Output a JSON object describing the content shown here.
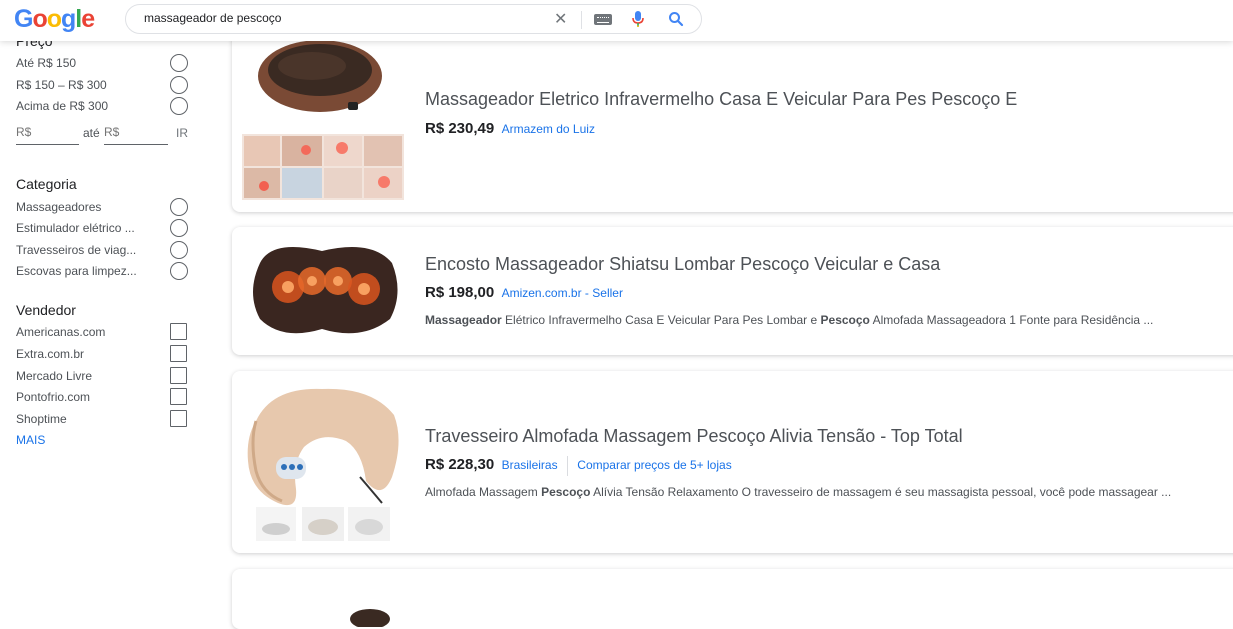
{
  "search": {
    "query": "massageador de pescoço"
  },
  "logo_text": "Google",
  "sidebar": {
    "price": {
      "heading": "Preço",
      "options": [
        "Até R$ 150",
        "R$ 150 – R$ 300",
        "Acima de R$ 300"
      ],
      "min_placeholder": "R$",
      "between": "até",
      "max_placeholder": "R$",
      "go": "IR"
    },
    "category": {
      "heading": "Categoria",
      "options": [
        "Massageadores",
        "Estimulador elétrico ...",
        "Travesseiros de viag...",
        "Escovas para limpez..."
      ]
    },
    "seller": {
      "heading": "Vendedor",
      "options": [
        "Americanas.com",
        "Extra.com.br",
        "Mercado Livre",
        "Pontofrio.com",
        "Shoptime"
      ],
      "more": "MAIS"
    }
  },
  "results": [
    {
      "title": "Massageador Eletrico Infravermelho Casa E Veicular Para Pes Pescoço E",
      "price": "R$ 230,49",
      "merchant": "Armazem do Luiz"
    },
    {
      "title": "Encosto Massageador Shiatsu Lombar Pescoço Veicular e Casa",
      "price": "R$ 198,00",
      "merchant": "Amizen.com.br - Seller",
      "desc_bold1": "Massageador",
      "desc_mid": " Elétrico Infravermelho Casa E Veicular Para Pes Lombar e ",
      "desc_bold2": "Pescoço",
      "desc_end": " Almofada Massageadora 1 Fonte para Residência ..."
    },
    {
      "title": "Travesseiro Almofada Massagem Pescoço Alivia Tensão - Top Total",
      "price": "R$ 228,30",
      "merchant": "Brasileiras",
      "compare": "Comparar preços de 5+ lojas",
      "desc_start": "Almofada Massagem ",
      "desc_bold1": "Pescoço",
      "desc_end": " Alívia Tensão Relaxamento O travesseiro de massagem é seu massagista pessoal, você pode massagear ..."
    }
  ]
}
